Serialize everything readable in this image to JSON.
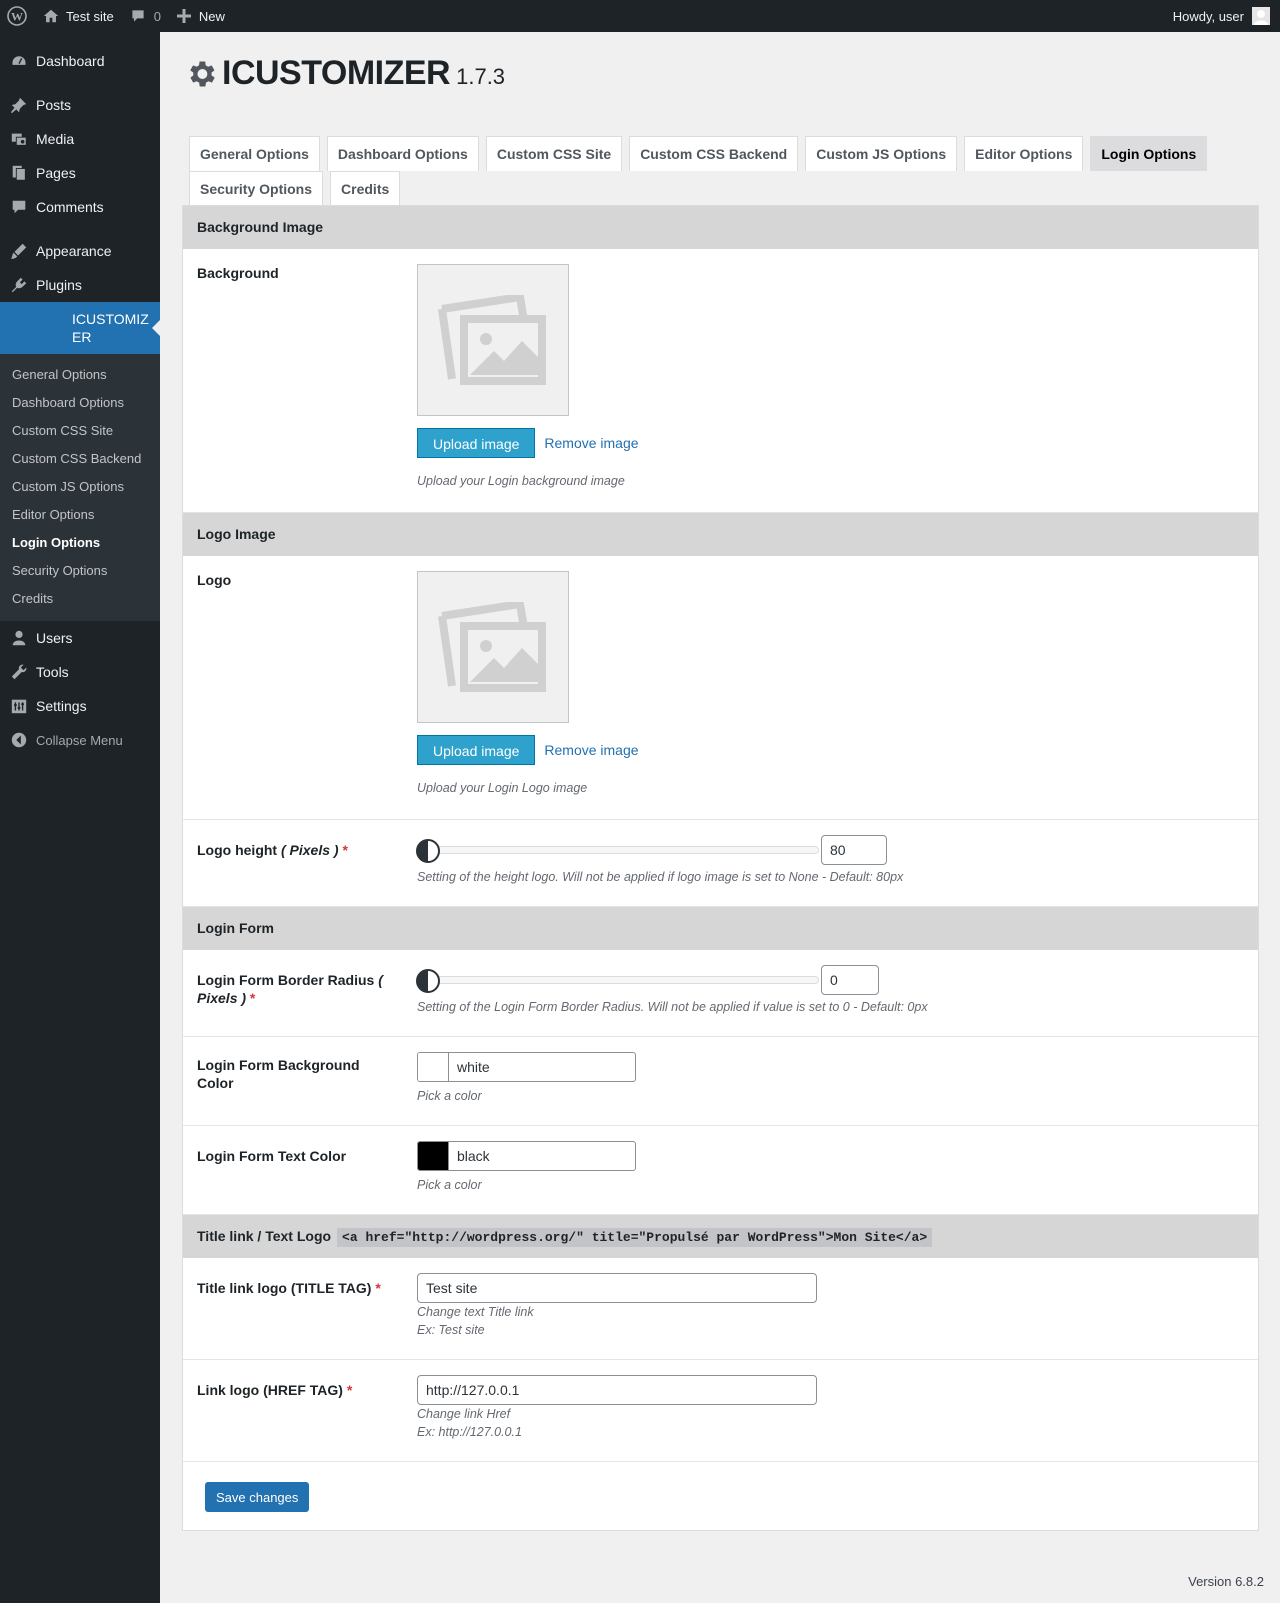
{
  "adminbar": {
    "site_name": "Test site",
    "comments_count": "0",
    "new_label": "New",
    "howdy": "Howdy, user"
  },
  "sidebar": {
    "items_top": [
      {
        "label": "Dashboard",
        "icon": "dashboard-icon"
      },
      {
        "label": "Posts",
        "icon": "pin-icon"
      },
      {
        "label": "Media",
        "icon": "media-icon"
      },
      {
        "label": "Pages",
        "icon": "pages-icon"
      },
      {
        "label": "Comments",
        "icon": "comment-icon"
      },
      {
        "label": "Appearance",
        "icon": "brush-icon"
      },
      {
        "label": "Plugins",
        "icon": "plugin-icon"
      }
    ],
    "current": "ICUSTOMIZER",
    "submenu": [
      "General Options",
      "Dashboard Options",
      "Custom CSS Site",
      "Custom CSS Backend",
      "Custom JS Options",
      "Editor Options",
      "Login Options",
      "Security Options",
      "Credits"
    ],
    "items_bottom": [
      {
        "label": "Users",
        "icon": "user-icon"
      },
      {
        "label": "Tools",
        "icon": "wrench-icon"
      },
      {
        "label": "Settings",
        "icon": "settings-icon"
      }
    ],
    "collapse": "Collapse Menu"
  },
  "header": {
    "title": "ICUSTOMIZER",
    "version": "1.7.3"
  },
  "tabs": [
    "General Options",
    "Dashboard Options",
    "Custom CSS Site",
    "Custom CSS Backend",
    "Custom JS Options",
    "Editor Options",
    "Login Options",
    "Security Options",
    "Credits"
  ],
  "active_tab": "Login Options",
  "sections": {
    "background": {
      "heading": "Background Image",
      "label": "Background",
      "upload": "Upload image",
      "remove": "Remove image",
      "desc": "Upload your Login background image"
    },
    "logo": {
      "heading": "Logo Image",
      "label": "Logo",
      "upload": "Upload image",
      "remove": "Remove image",
      "desc": "Upload your Login Logo image",
      "height_label": "Logo height",
      "height_unit": "( Pixels )",
      "height_value": "80",
      "height_desc": "Setting of the height logo. Will not be applied if logo image is set to None - Default: 80px"
    },
    "login_form": {
      "heading": "Login Form",
      "radius_label": "Login Form Border Radius",
      "radius_unit": "( Pixels )",
      "radius_value": "0",
      "radius_desc": "Setting of the Login Form Border Radius. Will not be applied if value is set to 0 - Default: 0px",
      "bg_label": "Login Form Background Color",
      "bg_value": "white",
      "bg_color": "#ffffff",
      "bg_desc": "Pick a color",
      "text_label": "Login Form Text Color",
      "text_value": "black",
      "text_color": "#000000",
      "text_desc": "Pick a color"
    },
    "title_link": {
      "heading": "Title link / Text Logo",
      "code": "<a href=\"http://wordpress.org/\" title=\"Propulsé par WordPress\">Mon Site</a>",
      "title_label": "Title link logo (TITLE TAG)",
      "title_value": "Test site",
      "title_desc": "Change text Title link",
      "title_example": "Ex: Test site",
      "href_label": "Link logo (HREF TAG)",
      "href_value": "http://127.0.0.1",
      "href_desc": "Change link Href",
      "href_example": "Ex: http://127.0.0.1"
    }
  },
  "save_label": "Save changes",
  "footer_version": "Version 6.8.2"
}
